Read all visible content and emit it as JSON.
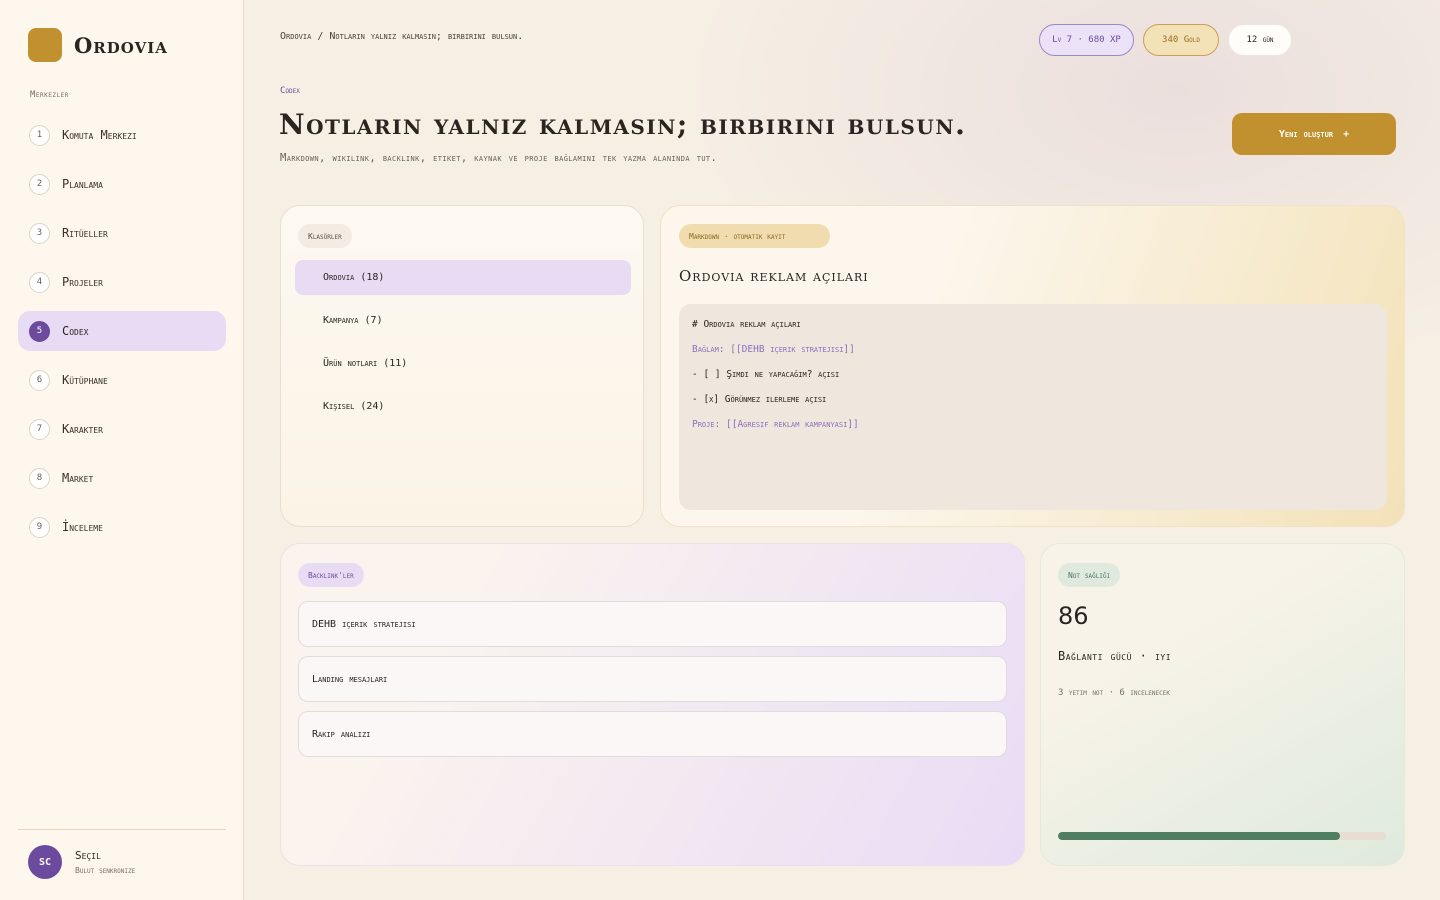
{
  "app": {
    "name": "Ordovia"
  },
  "sidebar": {
    "section_label": "Merkezler",
    "items": [
      {
        "num": "1",
        "label": "Komuta Merkezi",
        "active": false
      },
      {
        "num": "2",
        "label": "Planlama",
        "active": false
      },
      {
        "num": "3",
        "label": "Ritüeller",
        "active": false
      },
      {
        "num": "4",
        "label": "Projeler",
        "active": false
      },
      {
        "num": "5",
        "label": "Codex",
        "active": true
      },
      {
        "num": "6",
        "label": "Kütüphane",
        "active": false
      },
      {
        "num": "7",
        "label": "Karakter",
        "active": false
      },
      {
        "num": "8",
        "label": "Market",
        "active": false
      },
      {
        "num": "9",
        "label": "İnceleme",
        "active": false
      }
    ],
    "user": {
      "initials": "SC",
      "name": "Seçil",
      "status": "Bulut senkronize"
    }
  },
  "header": {
    "breadcrumb": "Ordovia / Notların yalnız kalmasın; birbirini bulsun.",
    "xp": "Lv 7 · 680 XP",
    "gold": "340 Gold",
    "streak": "12 gün",
    "eyebrow": "Codex",
    "title": "Notların yalnız kalmasın; birbirini bulsun.",
    "subtitle": "Markdown, wikilink, backlink, etiket, kaynak ve proje bağlamını tek yazma alanında tut.",
    "create_label": "Yeni oluştur",
    "create_icon": "+"
  },
  "folders": {
    "tag": "Klasörler",
    "items": [
      {
        "label": "Ordovia (18)",
        "active": true
      },
      {
        "label": "Kampanya (7)",
        "active": false
      },
      {
        "label": "Ürün notları (11)",
        "active": false
      },
      {
        "label": "Kişisel (24)",
        "active": false
      }
    ]
  },
  "editor": {
    "tag": "Markdown · otomatik kayıt",
    "title": "Ordovia reklam açıları",
    "lines": [
      {
        "text": "# Ordovia reklam açıları",
        "link": false
      },
      {
        "text": "Bağlam: [[DEHB içerik stratejisi]]",
        "link": true
      },
      {
        "text": "- [ ] Şimdi ne yapacağım? açısı",
        "link": false
      },
      {
        "text": "- [x] Görünmez ilerleme açısı",
        "link": false
      },
      {
        "text": "Proje: [[Agresif reklam kampanyası]]",
        "link": true
      }
    ]
  },
  "backlinks": {
    "tag": "Backlink'ler",
    "items": [
      {
        "label": "DEHB içerik stratejisi"
      },
      {
        "label": "Landing mesajları"
      },
      {
        "label": "Rakip analizi"
      }
    ]
  },
  "health": {
    "tag": "Not sağlığı",
    "score": "86",
    "strength": "Bağlantı gücü · iyi",
    "meta": "3 yetim not · 6 incelenecek",
    "progress": 0.86
  },
  "colors": {
    "accent": "#6c4b9e",
    "gold": "#c1902f",
    "success": "#4f7e62",
    "background": "#f6efe4"
  }
}
